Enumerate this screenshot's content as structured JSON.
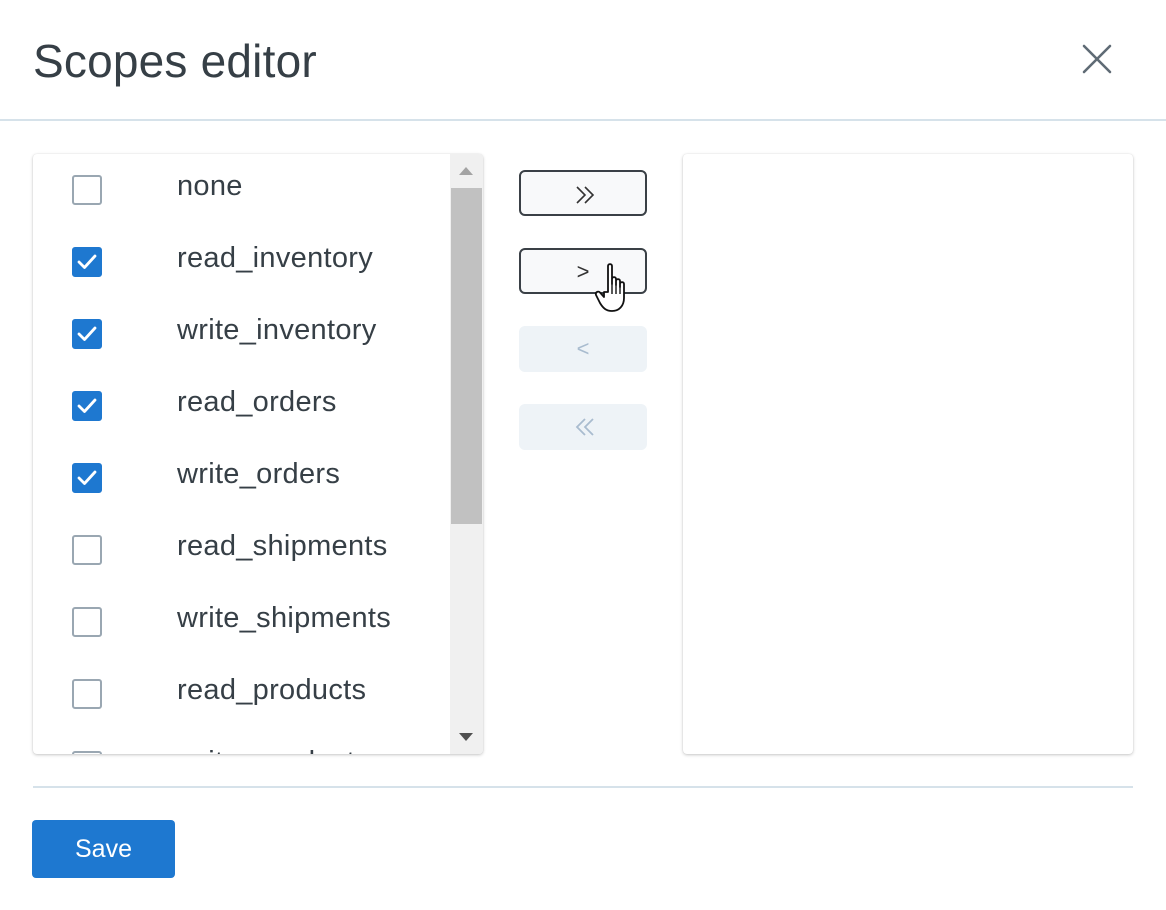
{
  "header": {
    "title": "Scopes editor"
  },
  "icons": {
    "close": "close-icon",
    "check": "checkmark-icon",
    "cursor": "hand-pointer-icon"
  },
  "source_list": {
    "items": [
      {
        "label": "none",
        "checked": false
      },
      {
        "label": "read_inventory",
        "checked": true
      },
      {
        "label": "write_inventory",
        "checked": true
      },
      {
        "label": "read_orders",
        "checked": true
      },
      {
        "label": "write_orders",
        "checked": true
      },
      {
        "label": "read_shipments",
        "checked": false
      },
      {
        "label": "write_shipments",
        "checked": false
      },
      {
        "label": "read_products",
        "checked": false
      },
      {
        "label": "write_products",
        "checked": false
      }
    ]
  },
  "transfer": {
    "move_all_right": {
      "icon": "double-chevron-right-icon",
      "enabled": true
    },
    "move_right": {
      "label": ">",
      "enabled": true
    },
    "move_left": {
      "label": "<",
      "enabled": false
    },
    "move_all_left": {
      "icon": "double-chevron-left-icon",
      "enabled": false
    }
  },
  "target_list": {
    "items": []
  },
  "footer": {
    "save_label": "Save"
  },
  "colors": {
    "accent": "#1e78d0",
    "divider": "#d6e2ea",
    "disabled_bg": "#eef3f7"
  }
}
